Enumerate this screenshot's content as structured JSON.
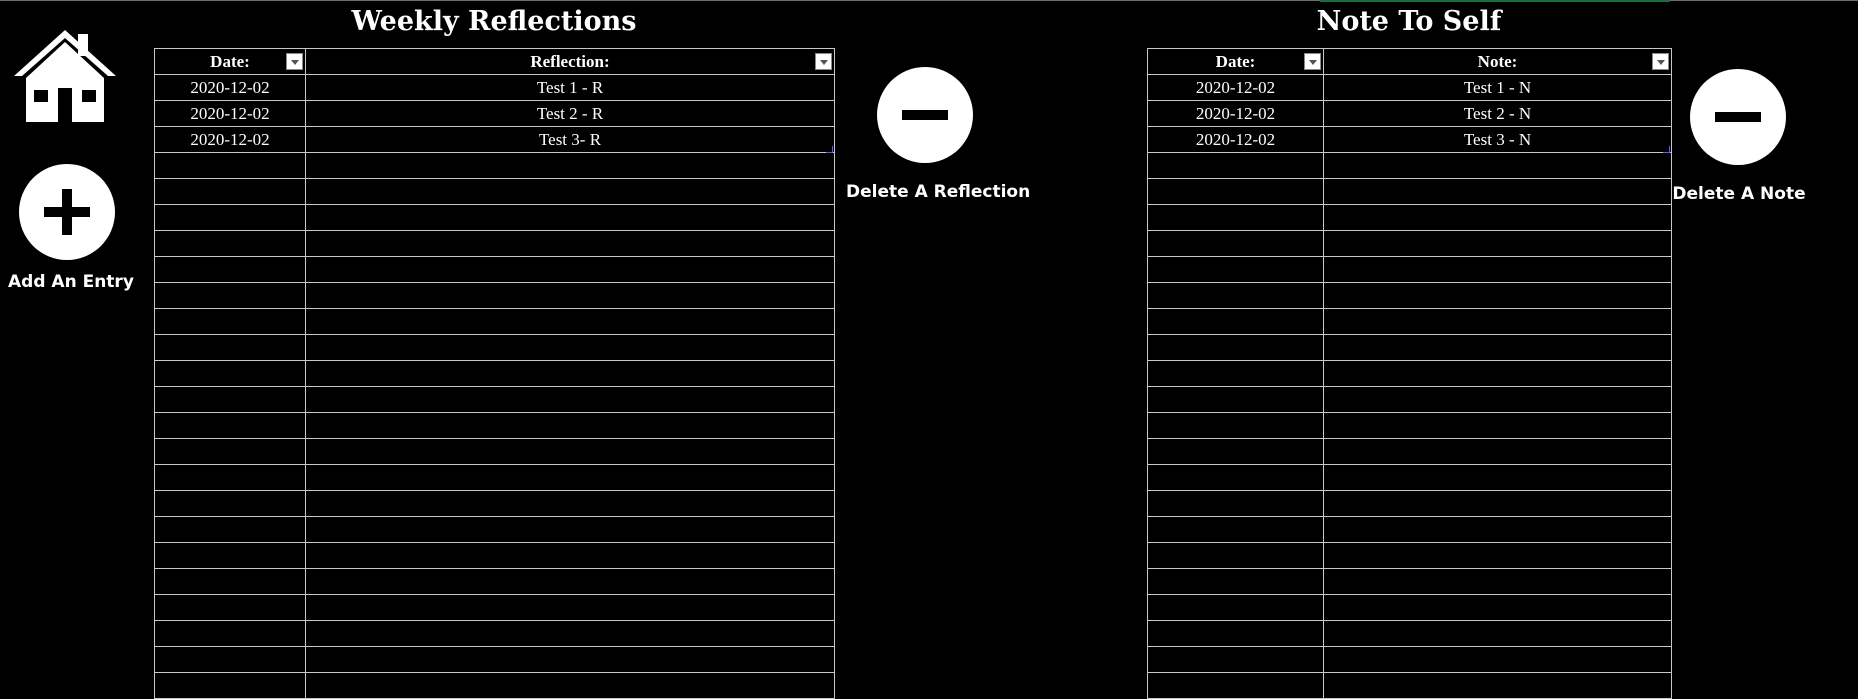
{
  "reflections": {
    "title": "Weekly Reflections",
    "headers": {
      "date": "Date:",
      "text": "Reflection:"
    },
    "rows": [
      {
        "date": "2020-12-02",
        "text": "Test 1 - R"
      },
      {
        "date": "2020-12-02",
        "text": "Test 2 - R"
      },
      {
        "date": "2020-12-02",
        "text": "Test 3- R"
      },
      {
        "date": "",
        "text": ""
      },
      {
        "date": "",
        "text": ""
      },
      {
        "date": "",
        "text": ""
      },
      {
        "date": "",
        "text": ""
      },
      {
        "date": "",
        "text": ""
      },
      {
        "date": "",
        "text": ""
      },
      {
        "date": "",
        "text": ""
      },
      {
        "date": "",
        "text": ""
      },
      {
        "date": "",
        "text": ""
      },
      {
        "date": "",
        "text": ""
      },
      {
        "date": "",
        "text": ""
      },
      {
        "date": "",
        "text": ""
      },
      {
        "date": "",
        "text": ""
      },
      {
        "date": "",
        "text": ""
      },
      {
        "date": "",
        "text": ""
      },
      {
        "date": "",
        "text": ""
      },
      {
        "date": "",
        "text": ""
      },
      {
        "date": "",
        "text": ""
      },
      {
        "date": "",
        "text": ""
      },
      {
        "date": "",
        "text": ""
      },
      {
        "date": "",
        "text": ""
      }
    ]
  },
  "notes": {
    "title": "Note To Self",
    "headers": {
      "date": "Date:",
      "text": "Note:"
    },
    "rows": [
      {
        "date": "2020-12-02",
        "text": "Test 1 - N"
      },
      {
        "date": "2020-12-02",
        "text": "Test 2 - N"
      },
      {
        "date": "2020-12-02",
        "text": "Test 3 - N"
      },
      {
        "date": "",
        "text": ""
      },
      {
        "date": "",
        "text": ""
      },
      {
        "date": "",
        "text": ""
      },
      {
        "date": "",
        "text": ""
      },
      {
        "date": "",
        "text": ""
      },
      {
        "date": "",
        "text": ""
      },
      {
        "date": "",
        "text": ""
      },
      {
        "date": "",
        "text": ""
      },
      {
        "date": "",
        "text": ""
      },
      {
        "date": "",
        "text": ""
      },
      {
        "date": "",
        "text": ""
      },
      {
        "date": "",
        "text": ""
      },
      {
        "date": "",
        "text": ""
      },
      {
        "date": "",
        "text": ""
      },
      {
        "date": "",
        "text": ""
      },
      {
        "date": "",
        "text": ""
      },
      {
        "date": "",
        "text": ""
      },
      {
        "date": "",
        "text": ""
      },
      {
        "date": "",
        "text": ""
      },
      {
        "date": "",
        "text": ""
      },
      {
        "date": "",
        "text": ""
      }
    ]
  },
  "buttons": {
    "add_entry": "Add An Entry",
    "delete_reflection": "Delete A Reflection",
    "delete_note": "Delete A Note"
  },
  "icons": {
    "home": "home-icon",
    "add": "plus-circle-icon",
    "delete": "minus-circle-icon",
    "filter": "filter-dropdown-icon"
  },
  "colors": {
    "background": "#000000",
    "text": "#ffffff",
    "grid": "#c8c8c8"
  }
}
